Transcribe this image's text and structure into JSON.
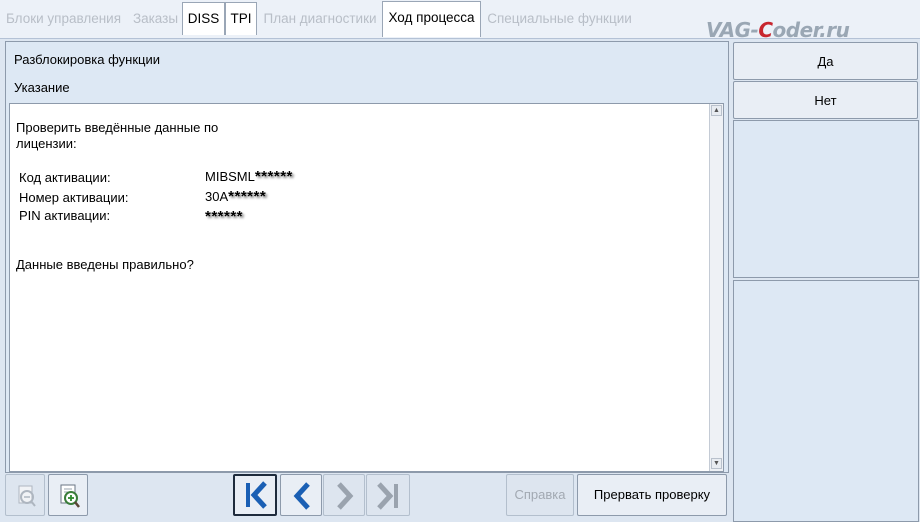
{
  "tabs": [
    {
      "label": "Блоки управления",
      "state": "disabled"
    },
    {
      "label": "Заказы",
      "state": "disabled"
    },
    {
      "label": "DISS",
      "state": "enabled"
    },
    {
      "label": "TPI",
      "state": "enabled"
    },
    {
      "label": "План диагностики",
      "state": "disabled"
    },
    {
      "label": "Ход процесса",
      "state": "active"
    },
    {
      "label": "Специальные функции",
      "state": "disabled"
    }
  ],
  "watermark": {
    "left": "VAG-",
    "c": "C",
    "right": "oder.ru"
  },
  "panel": {
    "title": "Разблокировка функции",
    "subtitle": "Указание",
    "instruction": "Проверить введённые данные по лицензии:",
    "fields": [
      {
        "label": "Код активации:",
        "value_prefix": "MIBSML",
        "value_mask": "******"
      },
      {
        "label": "Номер активации:",
        "value_prefix": "30A",
        "value_mask": "******"
      },
      {
        "label": "PIN активации:",
        "value_prefix": "",
        "value_mask": "******"
      }
    ],
    "question": "Данные введены правильно?"
  },
  "answers": {
    "yes_label": "Да",
    "no_label": "Нет"
  },
  "toolbar": {
    "help_label": "Справка",
    "abort_label": "Прервать проверку",
    "icons": [
      "zoom-out-icon",
      "zoom-in-document-icon",
      "first-step-icon",
      "previous-step-icon",
      "next-step-icon",
      "last-step-icon"
    ]
  },
  "colors": {
    "background": "#dde6f1",
    "nav_arrow_active": "#1a5fb4",
    "nav_arrow_disabled": "#9aa3ae",
    "watermark_accent": "#c8262e"
  }
}
